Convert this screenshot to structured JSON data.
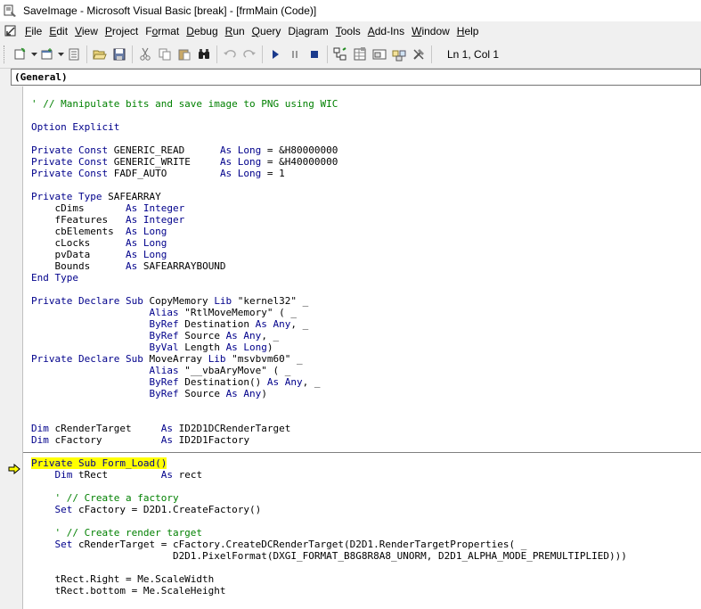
{
  "window": {
    "title": "SaveImage - Microsoft Visual Basic [break] - [frmMain (Code)]"
  },
  "menu": {
    "items": [
      {
        "label": "File",
        "key": "F",
        "rest": "ile"
      },
      {
        "label": "Edit",
        "key": "E",
        "rest": "dit"
      },
      {
        "label": "View",
        "key": "V",
        "rest": "iew"
      },
      {
        "label": "Project",
        "key": "P",
        "rest": "roject"
      },
      {
        "label": "Format",
        "key": "o",
        "pre": "F",
        "rest": "rmat"
      },
      {
        "label": "Debug",
        "key": "D",
        "rest": "ebug"
      },
      {
        "label": "Run",
        "key": "R",
        "rest": "un"
      },
      {
        "label": "Query",
        "key": "Q",
        "rest": "uery"
      },
      {
        "label": "Diagram",
        "key": "i",
        "pre": "D",
        "rest": "agram"
      },
      {
        "label": "Tools",
        "key": "T",
        "rest": "ools"
      },
      {
        "label": "Add-Ins",
        "key": "A",
        "rest": "dd-Ins"
      },
      {
        "label": "Window",
        "key": "W",
        "rest": "indow"
      },
      {
        "label": "Help",
        "key": "H",
        "rest": "elp"
      }
    ]
  },
  "toolbar": {
    "position_text": "Ln 1, Col 1",
    "icons": [
      "add-project-icon",
      "add-form-icon",
      "menu-editor-icon",
      "open-icon",
      "save-icon",
      "cut-icon",
      "copy-icon",
      "paste-icon",
      "find-icon",
      "undo-icon",
      "redo-icon",
      "start-icon",
      "break-icon",
      "end-icon",
      "project-explorer-icon",
      "properties-icon",
      "form-layout-icon",
      "object-browser-icon",
      "toolbox-icon"
    ]
  },
  "object_box": {
    "value": "(General)"
  },
  "code": {
    "lines": [
      {
        "segs": [
          {
            "t": ""
          }
        ]
      },
      {
        "segs": [
          {
            "t": "' // Manipulate bits and save image to PNG using WIC",
            "c": "cm"
          }
        ]
      },
      {
        "segs": [
          {
            "t": ""
          }
        ]
      },
      {
        "segs": [
          {
            "t": "Option Explicit",
            "c": "kw"
          }
        ]
      },
      {
        "segs": [
          {
            "t": ""
          }
        ]
      },
      {
        "segs": [
          {
            "t": "Private Const ",
            "c": "kw"
          },
          {
            "t": "GENERIC_READ      "
          },
          {
            "t": "As Long",
            "c": "kw"
          },
          {
            "t": " = &H80000000"
          }
        ]
      },
      {
        "segs": [
          {
            "t": "Private Const ",
            "c": "kw"
          },
          {
            "t": "GENERIC_WRITE     "
          },
          {
            "t": "As Long",
            "c": "kw"
          },
          {
            "t": " = &H40000000"
          }
        ]
      },
      {
        "segs": [
          {
            "t": "Private Const ",
            "c": "kw"
          },
          {
            "t": "FADF_AUTO         "
          },
          {
            "t": "As Long",
            "c": "kw"
          },
          {
            "t": " = 1"
          }
        ]
      },
      {
        "segs": [
          {
            "t": ""
          }
        ]
      },
      {
        "segs": [
          {
            "t": "Private Type ",
            "c": "kw"
          },
          {
            "t": "SAFEARRAY"
          }
        ]
      },
      {
        "segs": [
          {
            "t": "    cDims       "
          },
          {
            "t": "As Integer",
            "c": "kw"
          }
        ]
      },
      {
        "segs": [
          {
            "t": "    fFeatures   "
          },
          {
            "t": "As Integer",
            "c": "kw"
          }
        ]
      },
      {
        "segs": [
          {
            "t": "    cbElements  "
          },
          {
            "t": "As Long",
            "c": "kw"
          }
        ]
      },
      {
        "segs": [
          {
            "t": "    cLocks      "
          },
          {
            "t": "As Long",
            "c": "kw"
          }
        ]
      },
      {
        "segs": [
          {
            "t": "    pvData      "
          },
          {
            "t": "As Long",
            "c": "kw"
          }
        ]
      },
      {
        "segs": [
          {
            "t": "    Bounds      "
          },
          {
            "t": "As",
            "c": "kw"
          },
          {
            "t": " SAFEARRAYBOUND"
          }
        ]
      },
      {
        "segs": [
          {
            "t": "End Type",
            "c": "kw"
          }
        ]
      },
      {
        "segs": [
          {
            "t": ""
          }
        ]
      },
      {
        "segs": [
          {
            "t": "Private Declare Sub ",
            "c": "kw"
          },
          {
            "t": "CopyMemory "
          },
          {
            "t": "Lib",
            "c": "kw"
          },
          {
            "t": " \"kernel32\" _"
          }
        ]
      },
      {
        "segs": [
          {
            "t": "                    "
          },
          {
            "t": "Alias",
            "c": "kw"
          },
          {
            "t": " \"RtlMoveMemory\" ( _"
          }
        ]
      },
      {
        "segs": [
          {
            "t": "                    "
          },
          {
            "t": "ByRef",
            "c": "kw"
          },
          {
            "t": " Destination "
          },
          {
            "t": "As Any",
            "c": "kw"
          },
          {
            "t": ", _"
          }
        ]
      },
      {
        "segs": [
          {
            "t": "                    "
          },
          {
            "t": "ByRef",
            "c": "kw"
          },
          {
            "t": " Source "
          },
          {
            "t": "As Any",
            "c": "kw"
          },
          {
            "t": ", _"
          }
        ]
      },
      {
        "segs": [
          {
            "t": "                    "
          },
          {
            "t": "ByVal",
            "c": "kw"
          },
          {
            "t": " Length "
          },
          {
            "t": "As Long",
            "c": "kw"
          },
          {
            "t": ")"
          }
        ]
      },
      {
        "segs": [
          {
            "t": "Private Declare Sub ",
            "c": "kw"
          },
          {
            "t": "MoveArray "
          },
          {
            "t": "Lib",
            "c": "kw"
          },
          {
            "t": " \"msvbvm60\" _"
          }
        ]
      },
      {
        "segs": [
          {
            "t": "                    "
          },
          {
            "t": "Alias",
            "c": "kw"
          },
          {
            "t": " \"__vbaAryMove\" ( _"
          }
        ]
      },
      {
        "segs": [
          {
            "t": "                    "
          },
          {
            "t": "ByRef",
            "c": "kw"
          },
          {
            "t": " Destination() "
          },
          {
            "t": "As Any",
            "c": "kw"
          },
          {
            "t": ", _"
          }
        ]
      },
      {
        "segs": [
          {
            "t": "                    "
          },
          {
            "t": "ByRef",
            "c": "kw"
          },
          {
            "t": " Source "
          },
          {
            "t": "As Any",
            "c": "kw"
          },
          {
            "t": ")"
          }
        ]
      },
      {
        "segs": [
          {
            "t": ""
          }
        ]
      },
      {
        "segs": [
          {
            "t": ""
          }
        ]
      },
      {
        "segs": [
          {
            "t": "Dim",
            "c": "kw"
          },
          {
            "t": " cRenderTarget     "
          },
          {
            "t": "As",
            "c": "kw"
          },
          {
            "t": " ID2D1DCRenderTarget"
          }
        ]
      },
      {
        "segs": [
          {
            "t": "Dim",
            "c": "kw"
          },
          {
            "t": " cFactory          "
          },
          {
            "t": "As",
            "c": "kw"
          },
          {
            "t": " ID2D1Factory"
          }
        ]
      },
      {
        "segs": [
          {
            "t": ""
          }
        ]
      },
      {
        "segs": [
          {
            "t": "Private Sub Form_Load()",
            "c": "kw",
            "hl": true
          }
        ]
      },
      {
        "segs": [
          {
            "t": "    "
          },
          {
            "t": "Dim",
            "c": "kw"
          },
          {
            "t": " tRect         "
          },
          {
            "t": "As",
            "c": "kw"
          },
          {
            "t": " rect"
          }
        ]
      },
      {
        "segs": [
          {
            "t": ""
          }
        ]
      },
      {
        "segs": [
          {
            "t": "    ' // Create a factory",
            "c": "cm"
          }
        ]
      },
      {
        "segs": [
          {
            "t": "    "
          },
          {
            "t": "Set",
            "c": "kw"
          },
          {
            "t": " cFactory = D2D1.CreateFactory()"
          }
        ]
      },
      {
        "segs": [
          {
            "t": ""
          }
        ]
      },
      {
        "segs": [
          {
            "t": "    ' // Create render target",
            "c": "cm"
          }
        ]
      },
      {
        "segs": [
          {
            "t": "    "
          },
          {
            "t": "Set",
            "c": "kw"
          },
          {
            "t": " cRenderTarget = cFactory.CreateDCRenderTarget(D2D1.RenderTargetProperties( _"
          }
        ]
      },
      {
        "segs": [
          {
            "t": "                        D2D1.PixelFormat(DXGI_FORMAT_B8G8R8A8_UNORM, D2D1_ALPHA_MODE_PREMULTIPLIED)))"
          }
        ]
      },
      {
        "segs": [
          {
            "t": ""
          }
        ]
      },
      {
        "segs": [
          {
            "t": "    tRect.Right = Me.ScaleWidth"
          }
        ]
      },
      {
        "segs": [
          {
            "t": "    tRect.bottom = Me.ScaleHeight"
          }
        ]
      }
    ]
  }
}
